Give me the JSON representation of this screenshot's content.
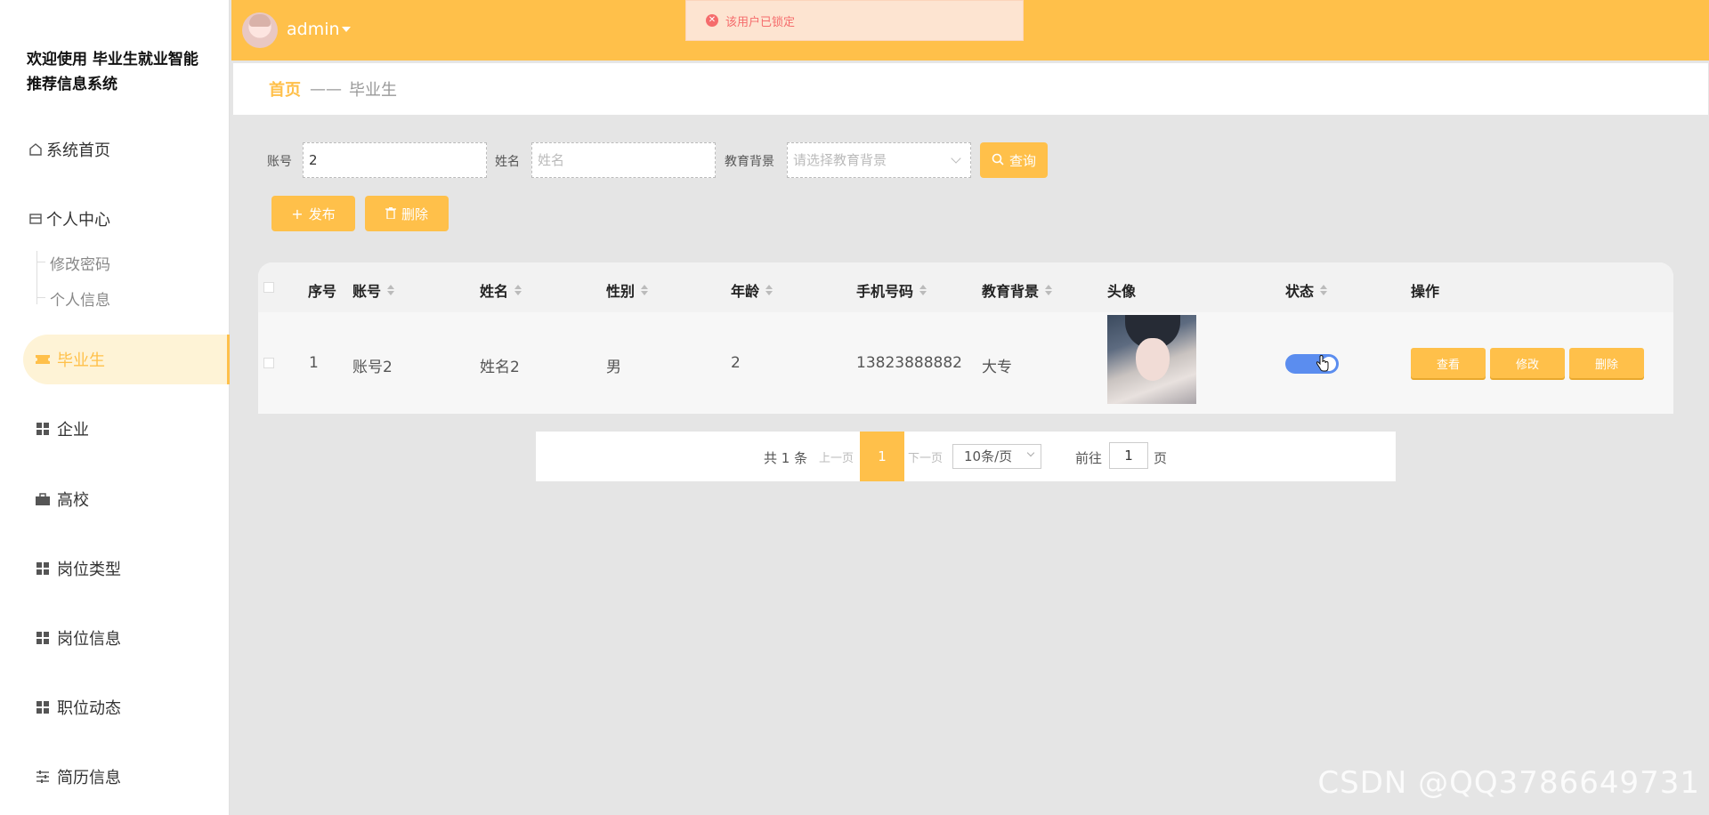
{
  "app": {
    "title": "欢迎使用 毕业生就业智能推荐信息系统"
  },
  "header": {
    "username": "admin"
  },
  "toast": {
    "message": "该用户已锁定"
  },
  "sidebar": {
    "home": "系统首页",
    "personal": "个人中心",
    "personal_sub": [
      "修改密码",
      "个人信息"
    ],
    "items": [
      "毕业生",
      "企业",
      "高校",
      "岗位类型",
      "岗位信息",
      "职位动态",
      "简历信息"
    ]
  },
  "breadcrumb": {
    "home": "首页",
    "separator": "——",
    "current": "毕业生"
  },
  "search": {
    "account_label": "账号",
    "account_value": "2",
    "name_label": "姓名",
    "name_placeholder": "姓名",
    "edu_label": "教育背景",
    "edu_placeholder": "请选择教育背景",
    "query_button": "查询"
  },
  "actions": {
    "publish": "发布",
    "delete": "删除"
  },
  "table": {
    "columns": [
      "序号",
      "账号",
      "姓名",
      "性别",
      "年龄",
      "手机号码",
      "教育背景",
      "头像",
      "状态",
      "操作"
    ],
    "rows": [
      {
        "index": "1",
        "account": "账号2",
        "name": "姓名2",
        "gender": "男",
        "age": "2",
        "phone": "13823888882",
        "education": "大专",
        "status_on": true
      }
    ],
    "row_buttons": {
      "view": "查看",
      "edit": "修改",
      "delete": "删除"
    }
  },
  "pagination": {
    "total": "共 1 条",
    "prev": "上一页",
    "current": "1",
    "next": "下一页",
    "page_size": "10条/页",
    "goto_label": "前往",
    "goto_value": "1",
    "goto_unit": "页"
  },
  "watermark": "CSDN @QQ3786649731",
  "colors": {
    "accent": "#ffc04a",
    "toggle": "#5b8def",
    "error": "#f56c6c"
  }
}
